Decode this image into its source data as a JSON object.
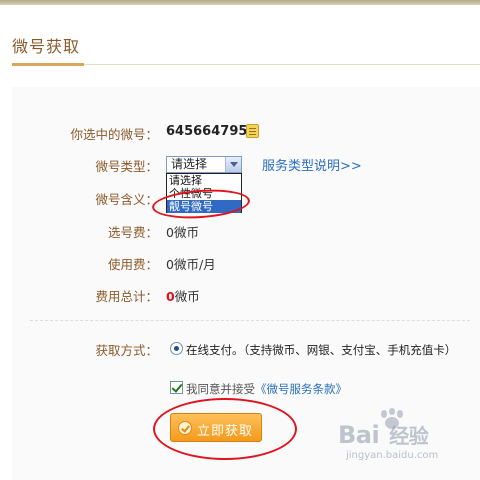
{
  "page": {
    "title": "微号获取"
  },
  "form": {
    "selected_label": "你选中的微号：",
    "selected_number": "645664795",
    "type_label": "微号类型：",
    "type_select_value": "请选择",
    "type_options": [
      "请选择",
      "个性微号",
      "靓号微号"
    ],
    "service_link": "服务类型说明>>",
    "meaning_label": "微号含义：",
    "select_fee_label": "选号费：",
    "select_fee_value": "0微币",
    "usage_fee_label": "使用费：",
    "usage_fee_value": "0微币/月",
    "total_label": "费用总计：",
    "total_amount": "0",
    "total_unit": "微币"
  },
  "payment": {
    "label": "获取方式：",
    "option": "在线支付。（支持微币、网银、支付宝、手机充值卡）"
  },
  "agreement": {
    "text": "我同意并接受",
    "link": "《微号服务条款》"
  },
  "button": {
    "label": "立即获取"
  },
  "watermark": {
    "brand": "Bai",
    "brand_suffix": "经验",
    "sub": "jingyan.baidu.com"
  },
  "colors": {
    "label": "#8a5a2b",
    "link": "#2a6fbd",
    "button": "#f39a1d",
    "annotation": "#e0141e",
    "selection": "#316ac5"
  },
  "icons": [
    "copy-icon",
    "select-arrow-icon",
    "radio-checked-icon",
    "checkbox-checked-icon",
    "button-coin-icon",
    "baidu-paw-icon"
  ]
}
